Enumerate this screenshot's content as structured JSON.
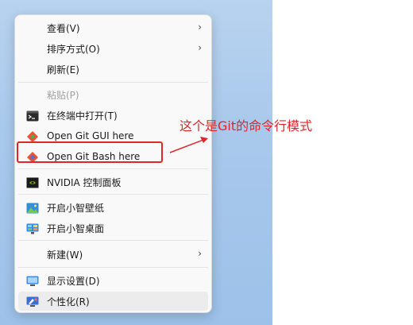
{
  "menu": {
    "items": [
      {
        "label": "查看(V)",
        "has_submenu": true,
        "icon": null
      },
      {
        "label": "排序方式(O)",
        "has_submenu": true,
        "icon": null
      },
      {
        "label": "刷新(E)",
        "has_submenu": false,
        "icon": null
      },
      {
        "label": "粘贴(P)",
        "has_submenu": false,
        "icon": null,
        "disabled": true
      },
      {
        "label": "在终端中打开(T)",
        "has_submenu": false,
        "icon": "terminal-icon"
      },
      {
        "label": "Open Git GUI here",
        "has_submenu": false,
        "icon": "git-gui-icon"
      },
      {
        "label": "Open Git Bash here",
        "has_submenu": false,
        "icon": "git-bash-icon"
      },
      {
        "label": "NVIDIA 控制面板",
        "has_submenu": false,
        "icon": "nvidia-icon"
      },
      {
        "label": "开启小智壁纸",
        "has_submenu": false,
        "icon": "wallpaper-icon"
      },
      {
        "label": "开启小智桌面",
        "has_submenu": false,
        "icon": "desktop-icon"
      },
      {
        "label": "新建(W)",
        "has_submenu": true,
        "icon": null
      },
      {
        "label": "显示设置(D)",
        "has_submenu": false,
        "icon": "display-icon"
      },
      {
        "label": "个性化(R)",
        "has_submenu": false,
        "icon": "personalize-icon"
      }
    ],
    "submenu_chevron": "›"
  },
  "annotation": {
    "text": "这个是Git的命令行模式",
    "color": "#e0262a"
  },
  "colors": {
    "accent_red": "#e0262a",
    "git_orange": "#f05033",
    "nvidia_green": "#76b900"
  }
}
